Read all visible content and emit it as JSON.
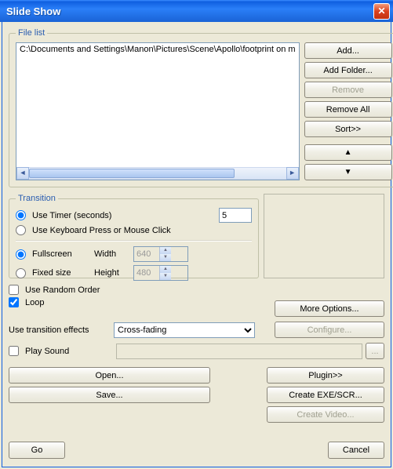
{
  "title": "Slide Show",
  "filelist": {
    "legend": "File list",
    "items": [
      "C:\\Documents and Settings\\Manon\\Pictures\\Scene\\Apollo\\footprint on m"
    ]
  },
  "buttons": {
    "add": "Add...",
    "add_folder": "Add Folder...",
    "remove": "Remove",
    "remove_all": "Remove All",
    "sort": "Sort>>",
    "up": "▲",
    "down": "▼"
  },
  "transition": {
    "legend": "Transition",
    "use_timer": "Use Timer (seconds)",
    "timer_value": "5",
    "use_keyboard": "Use Keyboard Press or Mouse Click",
    "fullscreen": "Fullscreen",
    "fixed_size": "Fixed size",
    "width_label": "Width",
    "height_label": "Height",
    "width_value": "640",
    "height_value": "480"
  },
  "options": {
    "random": "Use Random Order",
    "loop": "Loop",
    "effects_label": "Use transition effects",
    "effect_value": "Cross-fading",
    "more_options": "More Options...",
    "configure": "Configure...",
    "play_sound": "Play Sound"
  },
  "bottom": {
    "open": "Open...",
    "save": "Save...",
    "plugin": "Plugin>>",
    "create_exe": "Create EXE/SCR...",
    "create_video": "Create Video..."
  },
  "footer": {
    "go": "Go",
    "cancel": "Cancel"
  }
}
